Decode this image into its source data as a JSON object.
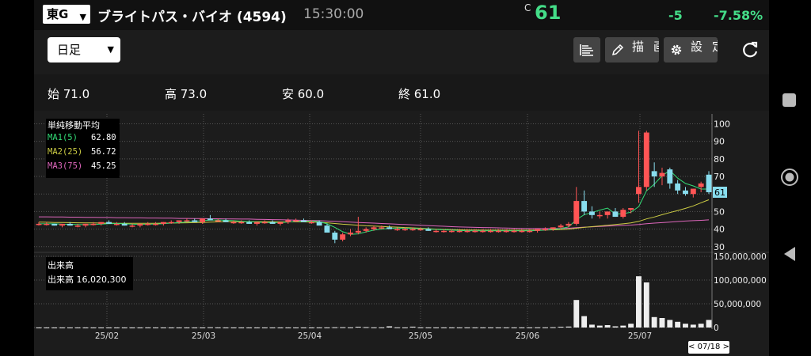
{
  "header": {
    "market": "東G",
    "stock_name": "ブライトパス・バイオ (4594)",
    "time": "15:30:00",
    "price_flag": "C",
    "price": "61",
    "change": "-5",
    "change_pct": "-7.58%"
  },
  "toolbar": {
    "period": "日足",
    "draw_label": "描画",
    "settings_label": "設定"
  },
  "ohlc": {
    "open": "始 71.0",
    "high": "高 73.0",
    "low": "安 60.0",
    "close": "終 61.0"
  },
  "ma_legend": {
    "title": "単純移動平均",
    "rows": [
      {
        "label": "MA1(5)",
        "value": "62.80",
        "color": "#33dd77"
      },
      {
        "label": "MA2(25)",
        "value": "56.72",
        "color": "#cccc44"
      },
      {
        "label": "MA3(75)",
        "value": "45.25",
        "color": "#dd66bb"
      }
    ]
  },
  "volume_legend": {
    "title": "出来高",
    "line": "出来高  16,020,300"
  },
  "colors": {
    "up": "#ff5555",
    "down": "#88ddee",
    "ma1": "#33dd77",
    "ma2": "#cccc44",
    "ma3": "#dd66bb",
    "accent": "#44dd88"
  },
  "chart_data": {
    "type": "candlestick",
    "price_axis": {
      "ticks": [
        100,
        90,
        80,
        70,
        60,
        50,
        40,
        30
      ],
      "range": [
        29,
        102
      ]
    },
    "volume_axis": {
      "ticks": [
        "150,000,000",
        "100,000,000",
        "50,000,000",
        "0"
      ],
      "values": [
        150000000,
        100000000,
        50000000,
        0
      ]
    },
    "current_price_label": "61",
    "x_ticks": [
      "25/02",
      "25/03",
      "25/04",
      "25/05",
      "25/06",
      "25/07"
    ],
    "selected_date": "< 07/18 >",
    "candles": [
      [
        43,
        44,
        42,
        43
      ],
      [
        43,
        44,
        42,
        43
      ],
      [
        43,
        43,
        42,
        42
      ],
      [
        42,
        43,
        41,
        43
      ],
      [
        43,
        44,
        42,
        42
      ],
      [
        42,
        43,
        41,
        42
      ],
      [
        42,
        43,
        41,
        43
      ],
      [
        43,
        44,
        42,
        43
      ],
      [
        43,
        44,
        42,
        44
      ],
      [
        44,
        45,
        43,
        43
      ],
      [
        43,
        44,
        42,
        43
      ],
      [
        43,
        44,
        42,
        42
      ],
      [
        42,
        43,
        41,
        42
      ],
      [
        42,
        43,
        41,
        43
      ],
      [
        43,
        44,
        42,
        43
      ],
      [
        43,
        44,
        42,
        43
      ],
      [
        43,
        44,
        42,
        44
      ],
      [
        44,
        45,
        43,
        44
      ],
      [
        44,
        45,
        43,
        45
      ],
      [
        45,
        46,
        44,
        45
      ],
      [
        45,
        46,
        44,
        44
      ],
      [
        44,
        46,
        43,
        46
      ],
      [
        46,
        48,
        45,
        45
      ],
      [
        45,
        46,
        44,
        45
      ],
      [
        45,
        46,
        44,
        44
      ],
      [
        44,
        45,
        43,
        44
      ],
      [
        44,
        45,
        43,
        44
      ],
      [
        44,
        45,
        43,
        43
      ],
      [
        43,
        44,
        42,
        44
      ],
      [
        44,
        45,
        43,
        44
      ],
      [
        44,
        45,
        43,
        43
      ],
      [
        43,
        44,
        42,
        44
      ],
      [
        44,
        46,
        43,
        45
      ],
      [
        45,
        46,
        44,
        45
      ],
      [
        45,
        46,
        44,
        44
      ],
      [
        44,
        45,
        43,
        44
      ],
      [
        44,
        45,
        43,
        42
      ],
      [
        42,
        43,
        38,
        38
      ],
      [
        38,
        39,
        32,
        34
      ],
      [
        34,
        38,
        33,
        37
      ],
      [
        37,
        40,
        36,
        38
      ],
      [
        38,
        47,
        37,
        39
      ],
      [
        39,
        41,
        38,
        40
      ],
      [
        40,
        42,
        39,
        41
      ],
      [
        41,
        42,
        40,
        41
      ],
      [
        41,
        42,
        40,
        40
      ],
      [
        40,
        41,
        39,
        40
      ],
      [
        40,
        41,
        39,
        40
      ],
      [
        40,
        41,
        39,
        40
      ],
      [
        40,
        41,
        39,
        40
      ],
      [
        40,
        41,
        39,
        39
      ],
      [
        39,
        40,
        38,
        39
      ],
      [
        39,
        40,
        38,
        39
      ],
      [
        39,
        40,
        38,
        39
      ],
      [
        39,
        40,
        38,
        39
      ],
      [
        39,
        40,
        38,
        39
      ],
      [
        39,
        40,
        38,
        39
      ],
      [
        39,
        40,
        38,
        39
      ],
      [
        39,
        40,
        38,
        39
      ],
      [
        39,
        40,
        38,
        39
      ],
      [
        39,
        40,
        38,
        39
      ],
      [
        39,
        40,
        38,
        39
      ],
      [
        39,
        40,
        38,
        39
      ],
      [
        39,
        40,
        38,
        39
      ],
      [
        39,
        40,
        38,
        40
      ],
      [
        40,
        41,
        39,
        40
      ],
      [
        40,
        41,
        39,
        41
      ],
      [
        41,
        43,
        40,
        42
      ],
      [
        42,
        44,
        41,
        43
      ],
      [
        43,
        64,
        42,
        56
      ],
      [
        56,
        62,
        48,
        50
      ],
      [
        50,
        53,
        46,
        48
      ],
      [
        48,
        50,
        46,
        48
      ],
      [
        48,
        50,
        46,
        50
      ],
      [
        50,
        52,
        47,
        47
      ],
      [
        47,
        52,
        46,
        51
      ],
      [
        51,
        52,
        49,
        52
      ],
      [
        60,
        96,
        55,
        64
      ],
      [
        64,
        96,
        62,
        95
      ],
      [
        73,
        78,
        64,
        70
      ],
      [
        70,
        75,
        65,
        72
      ],
      [
        74,
        75,
        63,
        66
      ],
      [
        66,
        68,
        60,
        62
      ],
      [
        62,
        64,
        59,
        60
      ],
      [
        60,
        63,
        58,
        63
      ],
      [
        64,
        67,
        61,
        66
      ],
      [
        71,
        73,
        60,
        61
      ]
    ],
    "volumes": [
      0.1,
      0.1,
      0.1,
      0.1,
      0.1,
      0.1,
      0.1,
      0.1,
      0.1,
      0.1,
      0.1,
      0.1,
      0.1,
      0.1,
      0.2,
      0.1,
      0.1,
      0.1,
      0.1,
      0.1,
      0.1,
      0.1,
      0.5,
      0.2,
      0.1,
      0.1,
      0.1,
      0.1,
      0.1,
      0.1,
      0.1,
      0.1,
      0.1,
      0.1,
      0.1,
      0.1,
      0.2,
      0.2,
      0.5,
      0.6,
      0.3,
      1.6,
      0.8,
      0.3,
      0.3,
      2.5,
      0.3,
      0.2,
      1.8,
      0.3,
      0.2,
      0.2,
      0.2,
      0.2,
      0.2,
      0.2,
      0.2,
      0.2,
      0.2,
      0.2,
      0.2,
      0.2,
      0.2,
      0.2,
      0.3,
      0.3,
      0.6,
      1.6,
      2.0,
      58.0,
      24.0,
      6.0,
      4.0,
      5.0,
      2.5,
      4.0,
      8.0,
      108.0,
      95.0,
      22.0,
      20.0,
      16.0,
      12.0,
      8.0,
      6.0,
      8.0,
      16.0
    ],
    "ma1": [
      43,
      43,
      43,
      42.8,
      42.7,
      42.6,
      42.5,
      42.6,
      42.9,
      43.1,
      43.2,
      43.0,
      42.8,
      42.7,
      42.8,
      42.9,
      43.1,
      43.4,
      43.7,
      44.1,
      44.4,
      44.8,
      45.1,
      45.2,
      45.0,
      44.8,
      44.5,
      44.2,
      43.9,
      43.8,
      43.7,
      43.8,
      44.0,
      44.3,
      44.5,
      44.6,
      44.2,
      43.0,
      41.0,
      38.5,
      37.0,
      37.3,
      38.4,
      39.4,
      40.0,
      40.4,
      40.6,
      40.5,
      40.4,
      40.2,
      40.0,
      39.8,
      39.6,
      39.4,
      39.2,
      39.1,
      39.0,
      39.0,
      39.0,
      39.0,
      39.0,
      39.0,
      39.0,
      39.0,
      39.2,
      39.4,
      39.8,
      40.4,
      41.2,
      45.4,
      48.2,
      49.4,
      50.8,
      52.0,
      48.6,
      48.8,
      49.6,
      52.8,
      61.8,
      65.6,
      70.4,
      73.4,
      69.0,
      66.0,
      64.6,
      62.8,
      62.8
    ],
    "ma2": [
      44.0,
      43.9,
      43.8,
      43.8,
      43.7,
      43.6,
      43.5,
      43.5,
      43.4,
      43.4,
      43.3,
      43.3,
      43.3,
      43.3,
      43.3,
      43.3,
      43.4,
      43.4,
      43.5,
      43.6,
      43.7,
      43.8,
      44.0,
      44.1,
      44.2,
      44.2,
      44.2,
      44.2,
      44.2,
      44.2,
      44.2,
      44.1,
      44.1,
      44.1,
      44.1,
      44.0,
      43.9,
      43.6,
      43.2,
      42.8,
      42.5,
      42.2,
      41.9,
      41.7,
      41.5,
      41.3,
      41.1,
      40.9,
      40.7,
      40.5,
      40.2,
      40.0,
      39.8,
      39.7,
      39.6,
      39.5,
      39.5,
      39.4,
      39.4,
      39.4,
      39.4,
      39.4,
      39.4,
      39.4,
      39.5,
      39.5,
      39.6,
      39.7,
      39.9,
      40.5,
      41.0,
      41.4,
      41.8,
      42.2,
      42.6,
      43.0,
      43.5,
      44.4,
      45.8,
      46.9,
      48.2,
      49.4,
      50.6,
      51.8,
      53.2,
      55.0,
      56.7
    ],
    "ma3": [
      47.0,
      47.0,
      46.9,
      46.9,
      46.8,
      46.8,
      46.7,
      46.7,
      46.6,
      46.6,
      46.5,
      46.5,
      46.4,
      46.4,
      46.3,
      46.3,
      46.2,
      46.2,
      46.1,
      46.1,
      46.0,
      46.0,
      45.9,
      45.9,
      45.8,
      45.8,
      45.7,
      45.7,
      45.6,
      45.5,
      45.4,
      45.3,
      45.2,
      45.1,
      45.0,
      44.9,
      44.8,
      44.6,
      44.4,
      44.2,
      44.0,
      43.8,
      43.6,
      43.4,
      43.2,
      43.0,
      42.8,
      42.6,
      42.4,
      42.2,
      42.0,
      41.8,
      41.6,
      41.4,
      41.2,
      41.1,
      41.0,
      40.9,
      40.8,
      40.7,
      40.6,
      40.5,
      40.4,
      40.3,
      40.3,
      40.3,
      40.3,
      40.4,
      40.5,
      40.8,
      41.1,
      41.3,
      41.5,
      41.7,
      41.9,
      42.1,
      42.3,
      42.6,
      43.1,
      43.4,
      43.7,
      44.0,
      44.3,
      44.6,
      44.8,
      45.0,
      45.25
    ]
  }
}
